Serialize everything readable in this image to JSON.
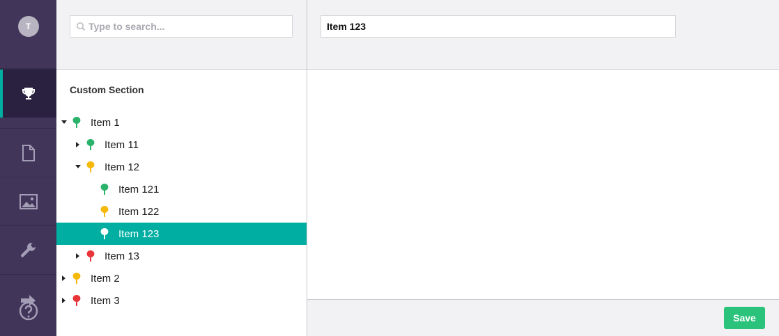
{
  "user": {
    "avatar_initial": "T"
  },
  "rail": {
    "items": [
      {
        "icon": "trophy-icon",
        "active": true
      },
      {
        "icon": "document-icon",
        "active": false
      },
      {
        "icon": "image-icon",
        "active": false
      },
      {
        "icon": "wrench-icon",
        "active": false
      },
      {
        "icon": "help-icon",
        "active": false
      }
    ]
  },
  "search": {
    "placeholder": "Type to search...",
    "value": ""
  },
  "tree": {
    "section_title": "Custom Section",
    "nodes": [
      {
        "label": "Item 1",
        "level": 0,
        "expander": "expanded",
        "color": "#2bb36b",
        "selected": false
      },
      {
        "label": "Item 11",
        "level": 1,
        "expander": "collapsed",
        "color": "#2bb36b",
        "selected": false
      },
      {
        "label": "Item 12",
        "level": 1,
        "expander": "expanded",
        "color": "#f5b90b",
        "selected": false
      },
      {
        "label": "Item 121",
        "level": 2,
        "expander": "none",
        "color": "#2bb36b",
        "selected": false
      },
      {
        "label": "Item 122",
        "level": 2,
        "expander": "none",
        "color": "#f5b90b",
        "selected": false
      },
      {
        "label": "Item 123",
        "level": 2,
        "expander": "none",
        "color": "#ffffff",
        "selected": true
      },
      {
        "label": "Item 13",
        "level": 1,
        "expander": "collapsed",
        "color": "#e8353a",
        "selected": false
      },
      {
        "label": "Item 2",
        "level": 0,
        "expander": "collapsed",
        "color": "#f5b90b",
        "selected": false
      },
      {
        "label": "Item 3",
        "level": 0,
        "expander": "collapsed",
        "color": "#e8353a",
        "selected": false
      }
    ]
  },
  "editor": {
    "name_value": "Item 123",
    "save_label": "Save"
  },
  "colors": {
    "rail_bg": "#413659",
    "accent": "#00aea2",
    "save": "#2bc37c"
  }
}
